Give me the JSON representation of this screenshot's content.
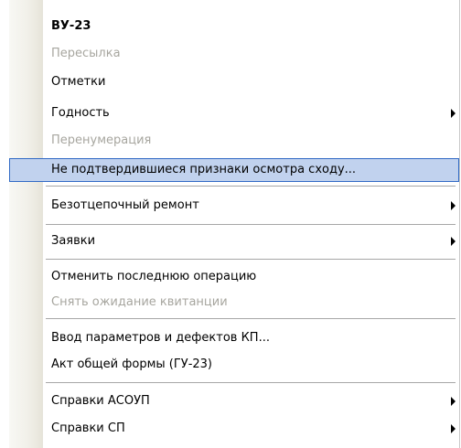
{
  "menu": {
    "items": [
      {
        "label": "ВУ-23"
      },
      {
        "label": "Пересылка"
      },
      {
        "label": "Отметки"
      },
      {
        "label": "Годность"
      },
      {
        "label": "Перенумерация"
      },
      {
        "label": "Не подтвердившиеся признаки осмотра сходу..."
      },
      {
        "label": "Безотцепочный ремонт"
      },
      {
        "label": "Заявки"
      },
      {
        "label": "Отменить последнюю операцию"
      },
      {
        "label": "Снять ожидание квитанции"
      },
      {
        "label": "Ввод параметров и дефектов КП..."
      },
      {
        "label": "Акт общей формы (ГУ-23)"
      },
      {
        "label": "Справки АСОУП"
      },
      {
        "label": "Справки СП"
      }
    ]
  }
}
